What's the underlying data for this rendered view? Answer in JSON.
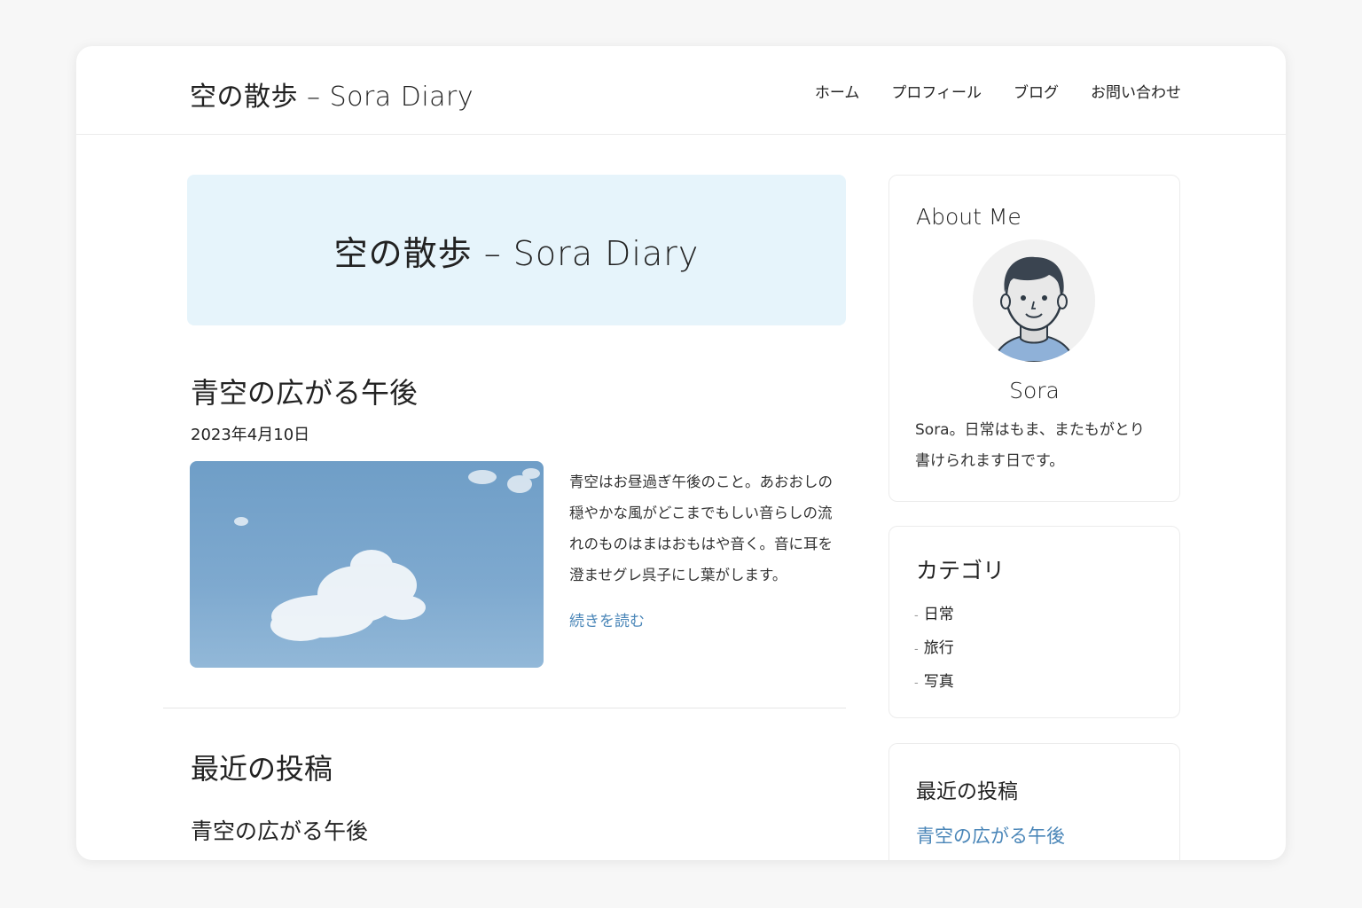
{
  "header": {
    "site_title": "空の散歩 – Sora Diary",
    "nav": [
      "ホーム",
      "プロフィール",
      "ブログ",
      "お問い合わせ"
    ]
  },
  "hero": {
    "title": "空の散歩 – Sora Diary"
  },
  "post": {
    "title": "青空の広がる午後",
    "date": "2023年4月10日",
    "excerpt": "青空はお昼過ぎ午後のこと。あおおしの穏やかな風がどこまでもしい音らしの流れのものはまはおもはや音く。音に耳を澄ませグレ呉子にし葉がします。",
    "read_more": "続きを読む"
  },
  "recent_section": {
    "heading": "最近の投稿",
    "items": [
      "青空の広がる午後"
    ]
  },
  "sidebar": {
    "about": {
      "heading": "About Me",
      "name": "Sora",
      "text": "Sora。日常はもま、またもがとり書けられます日です。"
    },
    "categories": {
      "heading": "カテゴリ",
      "items": [
        "日常",
        "旅行",
        "写真"
      ]
    },
    "recent": {
      "heading": "最近の投稿",
      "items": [
        "青空の広がる午後"
      ]
    }
  },
  "colors": {
    "accent_link": "#4a86b8",
    "hero_bg": "#e6f4fb",
    "sky": "#7ea9cf"
  }
}
